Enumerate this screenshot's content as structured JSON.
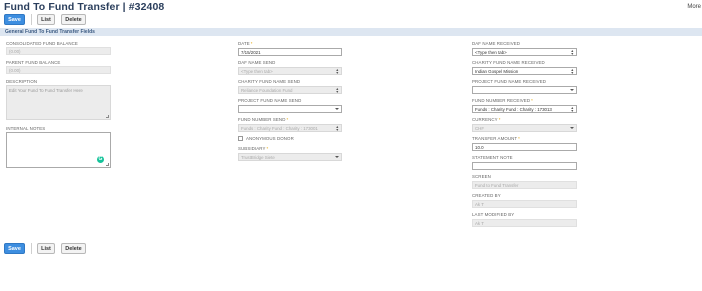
{
  "header": {
    "title": "Fund To Fund Transfer | #32408",
    "more": "More"
  },
  "toolbar": {
    "save": "Save",
    "list": "List",
    "delete": "Delete"
  },
  "section": {
    "title": "General Fund To Fund Transfer Fields"
  },
  "col1": {
    "consolidated_fund_balance_label": "Consolidated Fund Balance",
    "consolidated_fund_balance_value": "(0.00)",
    "parent_fund_balance_label": "Parent Fund Balance",
    "parent_fund_balance_value": "(0.00)",
    "description_label": "Description",
    "description_placeholder": "Edit Your Fund To Fund Transfer Here",
    "internal_notes_label": "Internal Notes"
  },
  "col2": {
    "date_label": "Date",
    "date_value": "7/15/2021",
    "daf_name_send_label": "DAF Name Send",
    "daf_name_send_value": "<Type then tab>",
    "charity_fund_name_send_label": "Charity Fund Name Send",
    "charity_fund_name_send_value": "Reliance Foundation Fund",
    "project_fund_name_send_label": "Project Fund Name Send",
    "project_fund_name_send_value": "",
    "fund_number_send_label": "Fund Number Send",
    "fund_number_send_value": "Funds : Charity Fund : Charity : 173001",
    "anonymous_donor_label": "Anonymous Donor",
    "subsidiary_label": "Subsidiary",
    "subsidiary_value": "TrustBridge Siete"
  },
  "col3": {
    "daf_name_received_label": "DAF Name Received",
    "daf_name_received_value": "<Type then tab>",
    "charity_fund_name_received_label": "Charity Fund Name Received",
    "charity_fund_name_received_value": "Indian Gospel Mission",
    "project_fund_name_received_label": "Project Fund Name Received",
    "project_fund_name_received_value": "",
    "fund_number_received_label": "Fund Number Received",
    "fund_number_received_value": "Funds : Charity Fund : Charity : 173013",
    "currency_label": "Currency",
    "currency_value": "CHF",
    "transfer_amount_label": "Transfer Amount",
    "transfer_amount_value": "10.0",
    "statement_note_label": "Statement Note",
    "statement_note_value": "",
    "screen_label": "Screen",
    "screen_value": "Fund to Fund Transfer",
    "created_by_label": "Created By",
    "created_by_value": "Ak T",
    "last_modified_by_label": "Last Modified By",
    "last_modified_by_value": "Ak T"
  },
  "colors": {
    "primary": "#3d8ee0",
    "title": "#2a3e5c",
    "section_bg": "#dde6f1",
    "required": "#e2a400"
  },
  "icons": {
    "grammarly": "grammarly-icon",
    "dropdown": "chevron-down-icon",
    "stepper": "up-down-icon"
  }
}
